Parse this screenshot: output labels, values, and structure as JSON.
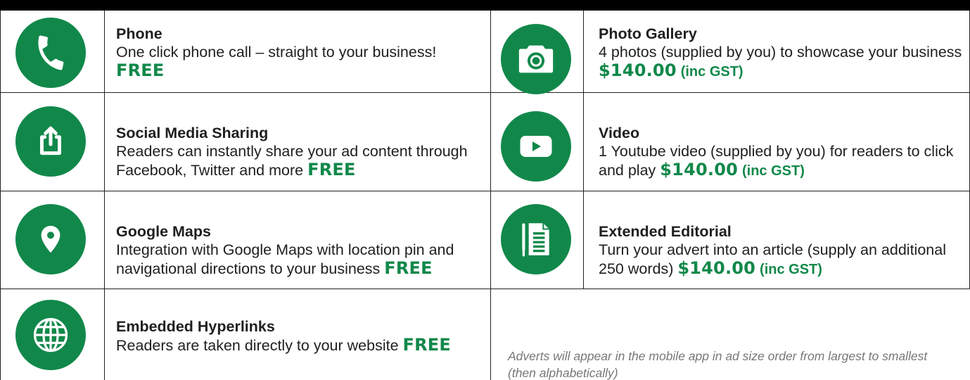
{
  "colors": {
    "accent": "#11884a",
    "border": "#222222",
    "header_bar": "#000000"
  },
  "features": [
    {
      "title": "Phone",
      "description": "One click phone call – straight to your business!",
      "price": "FREE",
      "suffix": "",
      "icon": "phone-icon"
    },
    {
      "title": "Photo Gallery",
      "description": "4 photos (supplied by you) to showcase your business",
      "price": "$140.00",
      "suffix": "(inc GST)",
      "icon": "camera-icon"
    },
    {
      "title": "Social Media Sharing",
      "description": "Readers can instantly share your ad content through Facebook, Twitter and more",
      "price": "FREE",
      "suffix": "",
      "icon": "share-icon"
    },
    {
      "title": "Video",
      "description": "1 Youtube video (supplied by you) for readers to click and play",
      "price": "$140.00",
      "suffix": "(inc GST)",
      "icon": "play-icon"
    },
    {
      "title": "Google Maps",
      "description": "Integration with Google Maps with location pin and navigational directions to your business",
      "price": "FREE",
      "suffix": "",
      "icon": "location-pin-icon"
    },
    {
      "title": "Extended Editorial",
      "description": "Turn your advert into an article (supply an additional 250 words)",
      "price": "$140.00",
      "suffix": "(inc GST)",
      "icon": "document-icon"
    },
    {
      "title": "Embedded Hyperlinks",
      "description": "Readers are taken directly to your website",
      "price": "FREE",
      "suffix": "",
      "icon": "globe-icon"
    }
  ],
  "note": "Adverts will appear in the mobile app in ad size order from largest to smallest (then alphabetically)"
}
